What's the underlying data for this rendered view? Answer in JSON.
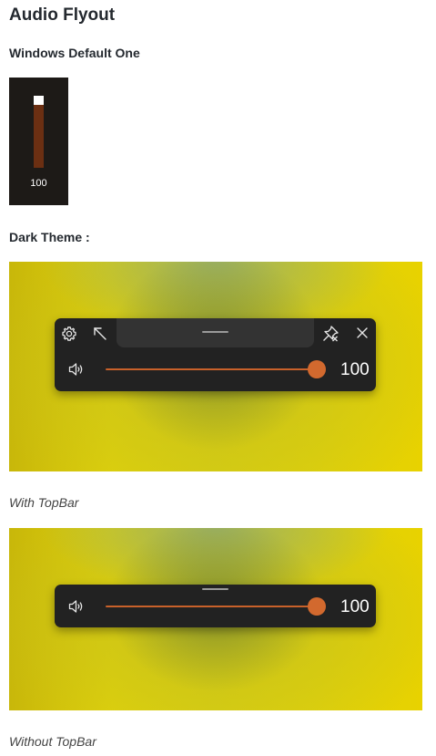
{
  "page": {
    "title": "Audio Flyout",
    "windows_heading": "Windows Default One",
    "dark_heading": "Dark Theme :",
    "caption_topbar": "With TopBar",
    "caption_no_topbar": "Without TopBar"
  },
  "windows_flyout": {
    "value": "100",
    "level": 1.0
  },
  "flyout_topbar": {
    "value": "100",
    "level": 1.0,
    "icons": [
      "gear-icon",
      "arrow-up-left-icon",
      "unpin-icon",
      "close-icon",
      "speaker-icon"
    ]
  },
  "flyout_no_topbar": {
    "value": "100",
    "level": 1.0,
    "icons": [
      "speaker-icon"
    ]
  },
  "colors": {
    "accent": "#d2692e",
    "flyout_bg": "#222222",
    "windows_bg": "#1d1a17"
  }
}
